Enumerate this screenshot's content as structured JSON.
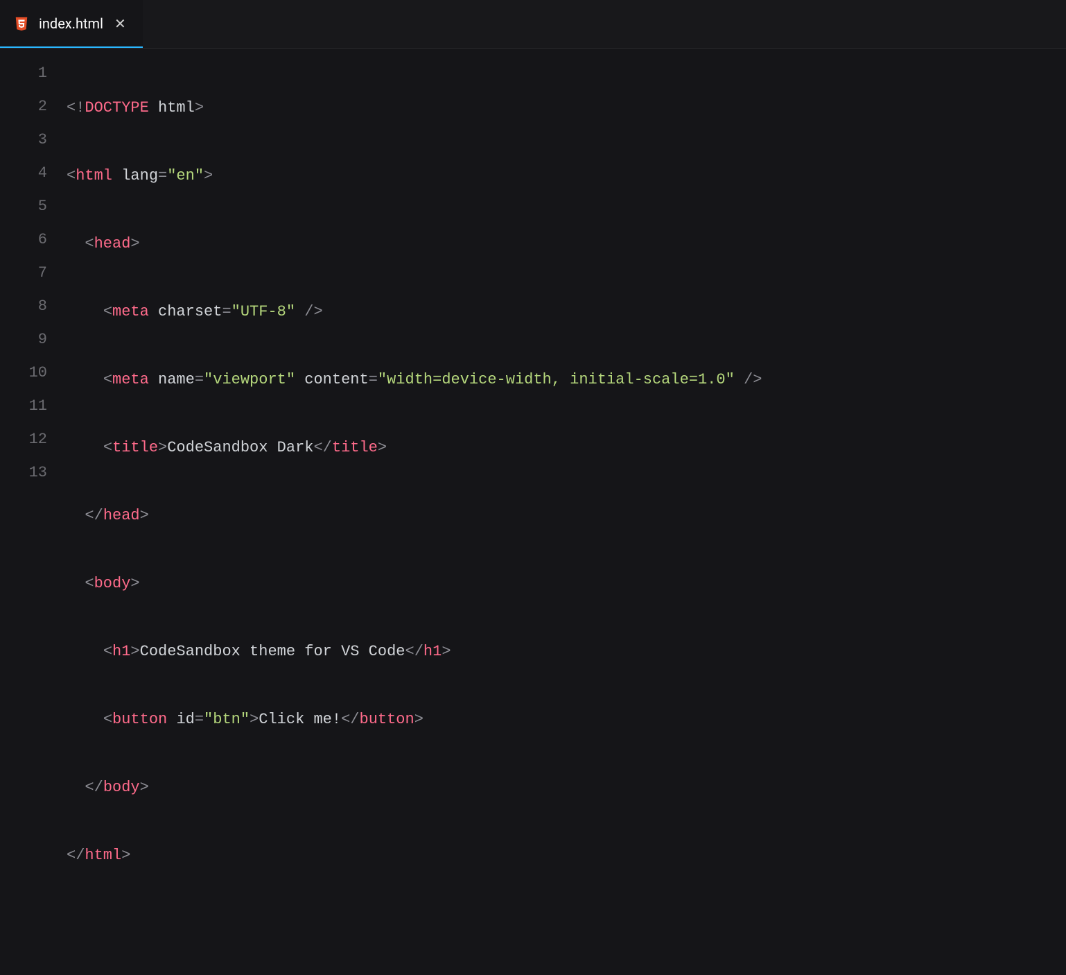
{
  "tab": {
    "filename": "index.html"
  },
  "lineNumbers": [
    "1",
    "2",
    "3",
    "4",
    "5",
    "6",
    "7",
    "8",
    "9",
    "10",
    "11",
    "12",
    "13"
  ],
  "code": {
    "l1": {
      "doctype_kw": "DOCTYPE",
      "doctype_val": "html"
    },
    "l2": {
      "tag": "html",
      "attr": "lang",
      "val": "\"en\""
    },
    "l3": {
      "tag": "head"
    },
    "l4": {
      "tag": "meta",
      "attr": "charset",
      "val": "\"UTF-8\""
    },
    "l5": {
      "tag": "meta",
      "attr1": "name",
      "val1": "\"viewport\"",
      "attr2": "content",
      "val2": "\"width=device-width, initial-scale=1.0\""
    },
    "l6": {
      "open": "title",
      "text": "CodeSandbox Dark",
      "close": "title"
    },
    "l7": {
      "tag": "head"
    },
    "l8": {
      "tag": "body"
    },
    "l9": {
      "open": "h1",
      "text": "CodeSandbox theme for VS Code",
      "close": "h1"
    },
    "l10": {
      "open": "button",
      "attr": "id",
      "val": "\"btn\"",
      "text": "Click me!",
      "close": "button"
    },
    "l11": {
      "tag": "body"
    },
    "l12": {
      "tag": "html"
    }
  }
}
